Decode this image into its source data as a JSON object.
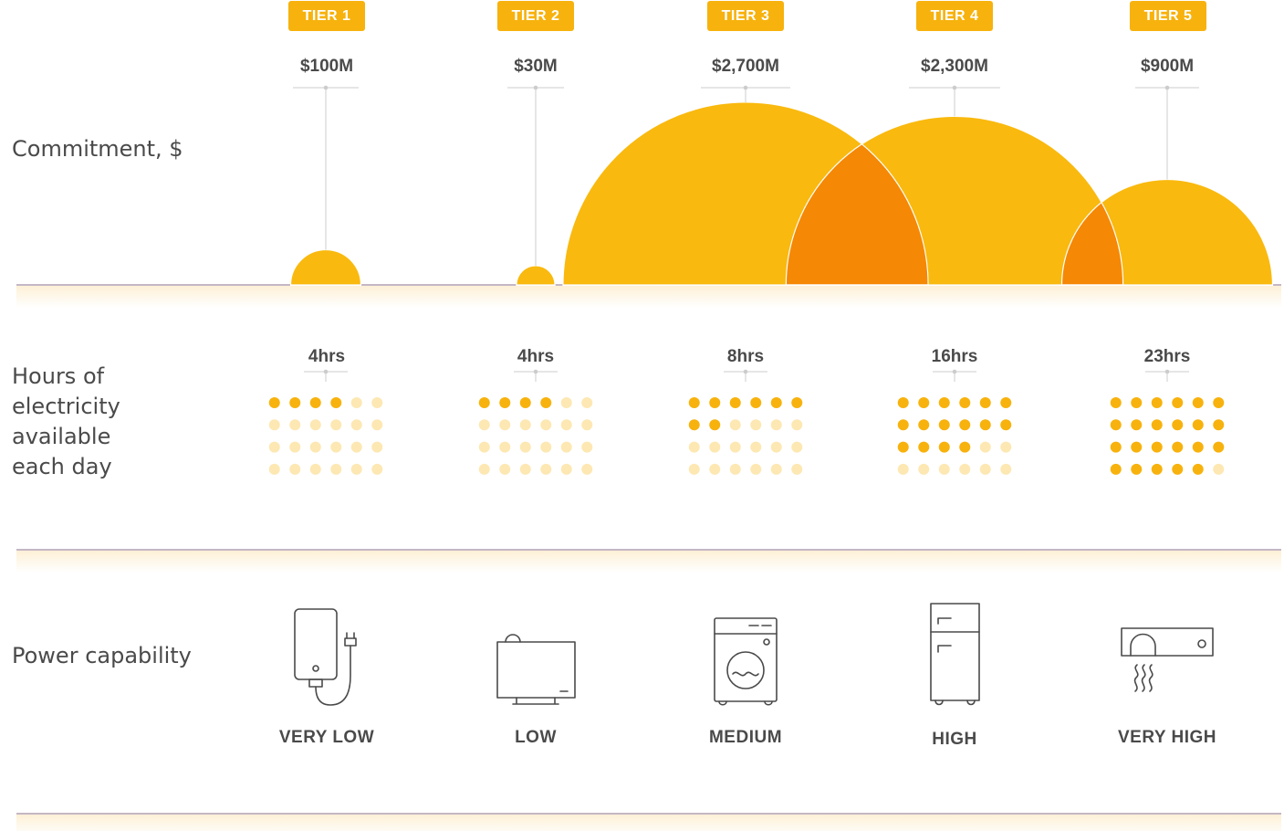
{
  "row_labels": {
    "commitment": "Commitment, $",
    "hours": "Hours of electricity available each day",
    "power": "Power capability"
  },
  "chart_data": {
    "type": "bubble",
    "title": "",
    "tiers": [
      "TIER 1",
      "TIER 2",
      "TIER 3",
      "TIER 4",
      "TIER 5"
    ],
    "commitment_usd_millions": [
      100,
      30,
      2700,
      2300,
      900
    ],
    "commitment_labels": [
      "$100M",
      "$30M",
      "$2,700M",
      "$2,300M",
      "$900M"
    ],
    "hours_per_day": [
      4,
      4,
      8,
      16,
      23
    ],
    "hours_labels": [
      "4hrs",
      "4hrs",
      "8hrs",
      "16hrs",
      "23hrs"
    ],
    "dots_per_day": 24,
    "power_capability": [
      "VERY LOW",
      "LOW",
      "MEDIUM",
      "HIGH",
      "VERY HIGH"
    ],
    "power_icons": [
      "water-heater-icon",
      "television-icon",
      "washing-machine-icon",
      "refrigerator-icon",
      "air-conditioner-icon"
    ]
  },
  "colors": {
    "bubble": "#f9b90e",
    "overlap": "#f58804",
    "badge": "#f7b20d",
    "dot_on": "#f7b20d",
    "dot_off": "#fde8b3",
    "divider": "#8b6f8b",
    "band": "#fdf3df",
    "icon": "#4a4a4a",
    "connector": "#cccccc"
  }
}
